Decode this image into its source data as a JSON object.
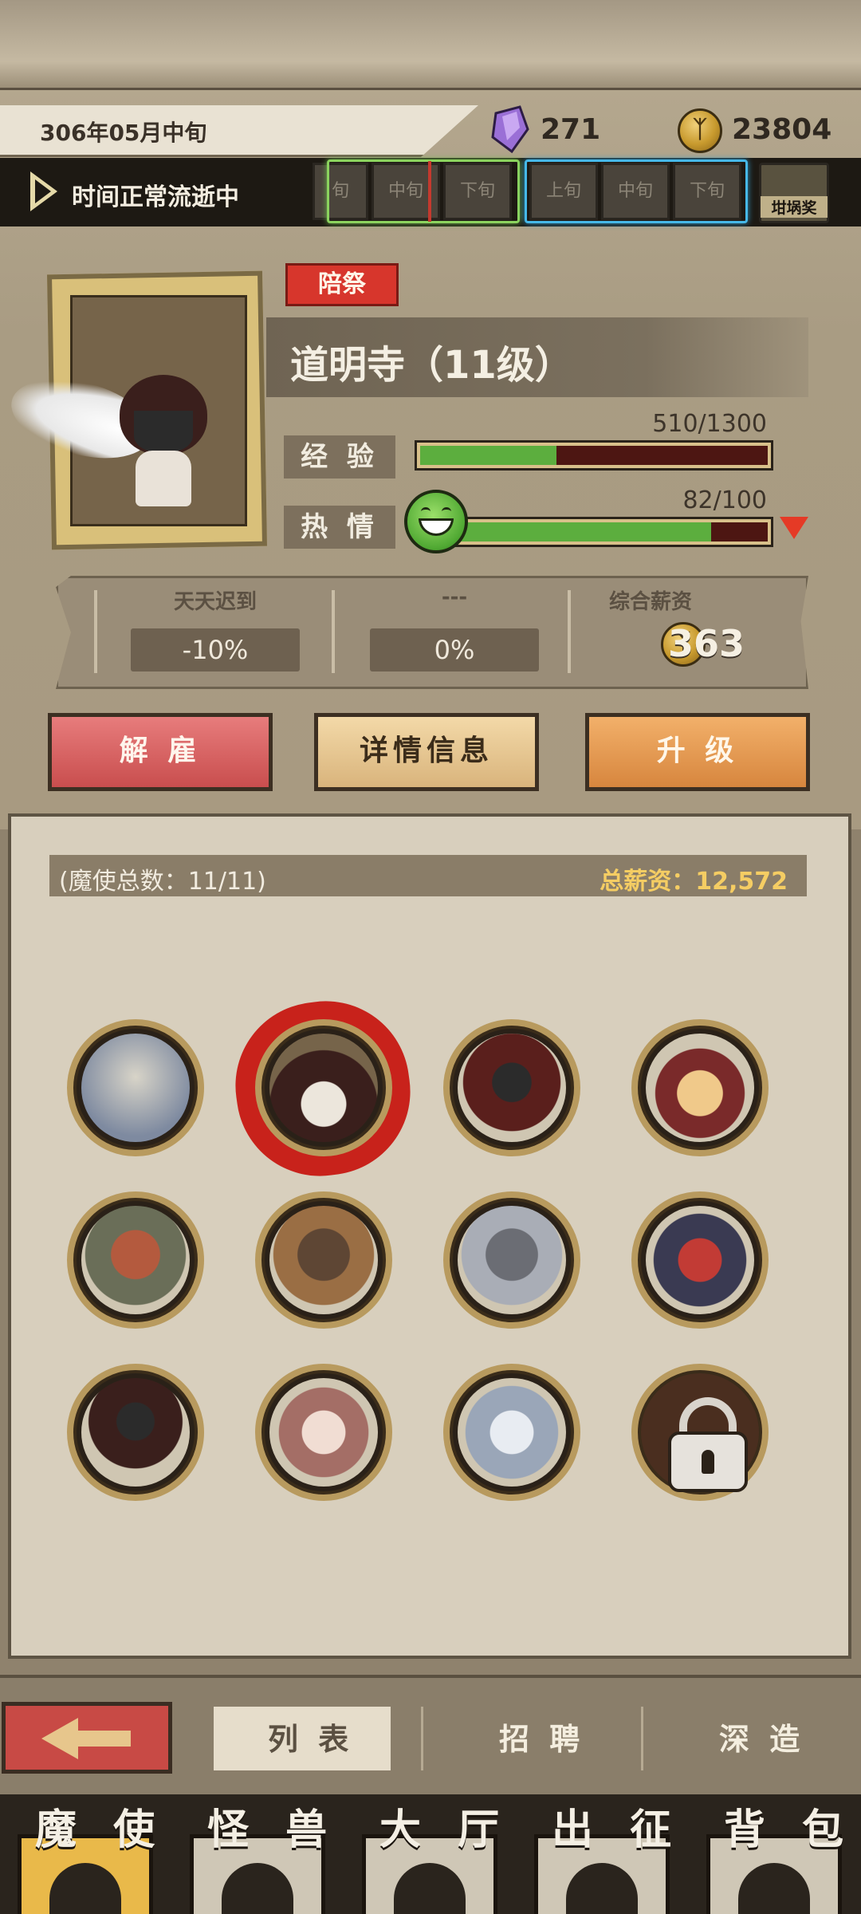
{
  "header": {
    "date": "306年05月中旬",
    "crystals": "271",
    "gold": "23804",
    "time_status": "时间正常流逝中",
    "periods_partial": "旬",
    "periods_current": [
      "中旬",
      "下旬"
    ],
    "periods_next": [
      "上旬",
      "中旬",
      "下旬"
    ],
    "jar_label": "坩埚奖"
  },
  "character": {
    "role": "陪祭",
    "name": "道明寺（11级）",
    "exp_label": "经 验",
    "exp_text": "510/1300",
    "exp_fraction": 0.392,
    "passion_label": "热 情",
    "passion_text": "82/100",
    "passion_fraction": 0.82,
    "modifiers": [
      {
        "title": "天天迟到",
        "value": "-10%"
      },
      {
        "title": "---",
        "value": "0%"
      }
    ],
    "salary_title": "综合薪资",
    "salary_value": "363"
  },
  "actions": {
    "fire": "解 雇",
    "detail": "详情信息",
    "upgrade": "升 级"
  },
  "roster": {
    "count_text": "(魔使总数：11/11)",
    "total_salary": "总薪资：12,572"
  },
  "subtabs": [
    "列 表",
    "招 聘",
    "深 造"
  ],
  "nav": [
    "魔 使",
    "怪 兽",
    "大 厅",
    "出 征",
    "背 包"
  ],
  "colors": {
    "exp_fill": "#5cae3e",
    "bar_track": "#4d1612",
    "fire_button": "#c94e4e",
    "upgrade_button": "#d7863e",
    "accent_gold": "#f5cd63"
  }
}
